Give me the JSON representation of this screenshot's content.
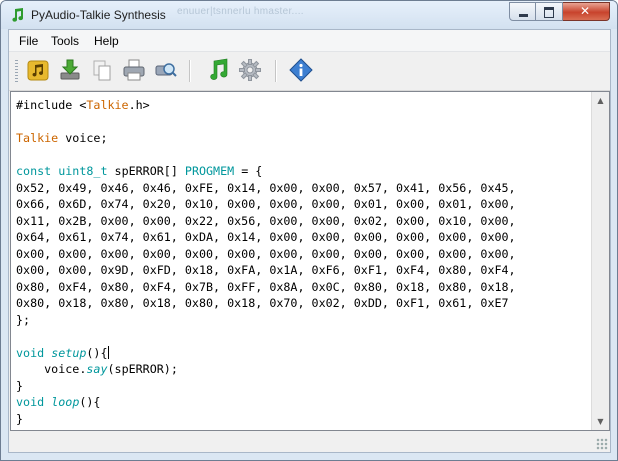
{
  "window": {
    "title": "PyAudio-Talkie Synthesis",
    "title_ghost": "enuuer|tsnnerlu hmaster...."
  },
  "menu": {
    "file": "File",
    "tools": "Tools",
    "help": "Help"
  },
  "toolbar": [
    {
      "icon": "open-audio-icon"
    },
    {
      "icon": "download-icon"
    },
    {
      "icon": "copy-icon"
    },
    {
      "icon": "print-icon"
    },
    {
      "icon": "search-icon"
    },
    {
      "icon": "music-note-icon"
    },
    {
      "icon": "gear-icon"
    },
    {
      "icon": "info-icon"
    }
  ],
  "editor": {
    "include": "#include <",
    "include_lib": "Talkie",
    "include_end": ".h>",
    "talkie_type": "Talkie",
    "voice_decl": " voice;",
    "const_kw": "const",
    "uint_type": "uint8_t",
    "array_decl": " spERROR[] ",
    "progmem_kw": "PROGMEM",
    "array_open": " = {",
    "data_lines": [
      "0x52, 0x49, 0x46, 0x46, 0xFE, 0x14, 0x00, 0x00, 0x57, 0x41, 0x56, 0x45,",
      "0x66, 0x6D, 0x74, 0x20, 0x10, 0x00, 0x00, 0x00, 0x01, 0x00, 0x01, 0x00,",
      "0x11, 0x2B, 0x00, 0x00, 0x22, 0x56, 0x00, 0x00, 0x02, 0x00, 0x10, 0x00,",
      "0x64, 0x61, 0x74, 0x61, 0xDA, 0x14, 0x00, 0x00, 0x00, 0x00, 0x00, 0x00,",
      "0x00, 0x00, 0x00, 0x00, 0x00, 0x00, 0x00, 0x00, 0x00, 0x00, 0x00, 0x00,",
      "0x00, 0x00, 0x9D, 0xFD, 0x18, 0xFA, 0x1A, 0xF6, 0xF1, 0xF4, 0x80, 0xF4,",
      "0x80, 0xF4, 0x80, 0xF4, 0x7B, 0xFF, 0x8A, 0x0C, 0x80, 0x18, 0x80, 0x18,",
      "0x80, 0x18, 0x80, 0x18, 0x80, 0x18, 0x70, 0x02, 0xDD, 0xF1, 0x61, 0xE7"
    ],
    "array_close": "};",
    "void_kw": "void",
    "setup_fn": "setup",
    "parens_brace": "(){",
    "indent_voice": "    voice.",
    "say_fn": "say",
    "say_args": "(spERROR);",
    "brace_close": "}",
    "loop_fn": "loop"
  },
  "status": {
    "text": ""
  }
}
